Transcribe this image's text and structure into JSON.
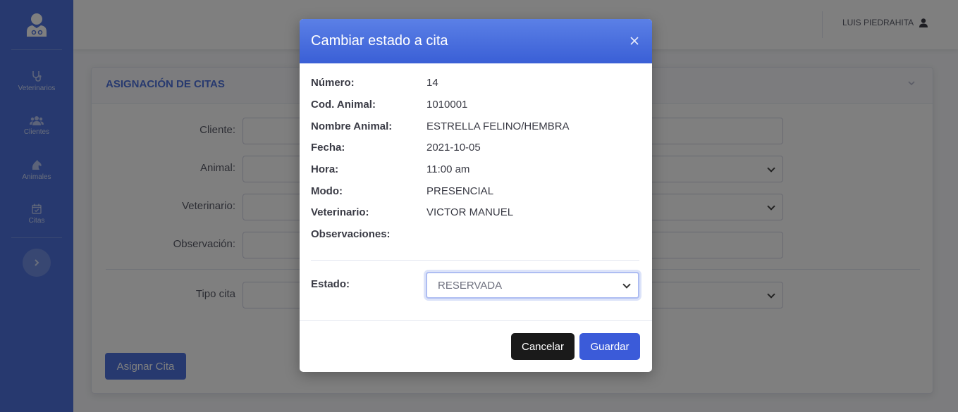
{
  "sidebar": {
    "brand_icon": "doctor-avatar-icon",
    "items": [
      {
        "label": "Veterinarios",
        "icon": "stethoscope-icon"
      },
      {
        "label": "Clientes",
        "icon": "users-icon"
      },
      {
        "label": "Animales",
        "icon": "horse-icon"
      },
      {
        "label": "Citas",
        "icon": "calendar-check-icon"
      }
    ],
    "toggle_icon": "chevron-right-icon"
  },
  "topbar": {
    "user_name": "LUIS PIEDRAHITA",
    "user_icon": "user-icon"
  },
  "card": {
    "title": "ASIGNACIÓN DE CITAS",
    "fields": {
      "cliente": {
        "label": "Cliente:",
        "value": ""
      },
      "animal": {
        "label": "Animal:",
        "value": ""
      },
      "veterinario": {
        "label": "Veterinario:",
        "value": ""
      },
      "observacion": {
        "label": "Observación:",
        "value": ""
      },
      "tipo_cita": {
        "label": "Tipo cita",
        "value": ""
      }
    },
    "assign_button": "Asignar Cita"
  },
  "modal": {
    "title": "Cambiar estado a cita",
    "close_icon": "close-icon",
    "details": [
      {
        "key": "Número:",
        "value": "14"
      },
      {
        "key": "Cod. Animal:",
        "value": "1010001"
      },
      {
        "key": "Nombre Animal:",
        "value": "ESTRELLA FELINO/HEMBRA"
      },
      {
        "key": "Fecha:",
        "value": "2021-10-05"
      },
      {
        "key": "Hora:",
        "value": "11:00 am"
      },
      {
        "key": "Modo:",
        "value": "PRESENCIAL"
      },
      {
        "key": "Veterinario:",
        "value": "VICTOR MANUEL"
      },
      {
        "key": "Observaciones:",
        "value": ""
      }
    ],
    "estado_label": "Estado:",
    "estado_value": "RESERVADA",
    "cancel_button": "Cancelar",
    "save_button": "Guardar"
  },
  "colors": {
    "sidebar": "#4e73df",
    "primary": "#4e73df",
    "save_button": "#3b5bd9",
    "cancel_button": "#1a1a1a"
  }
}
